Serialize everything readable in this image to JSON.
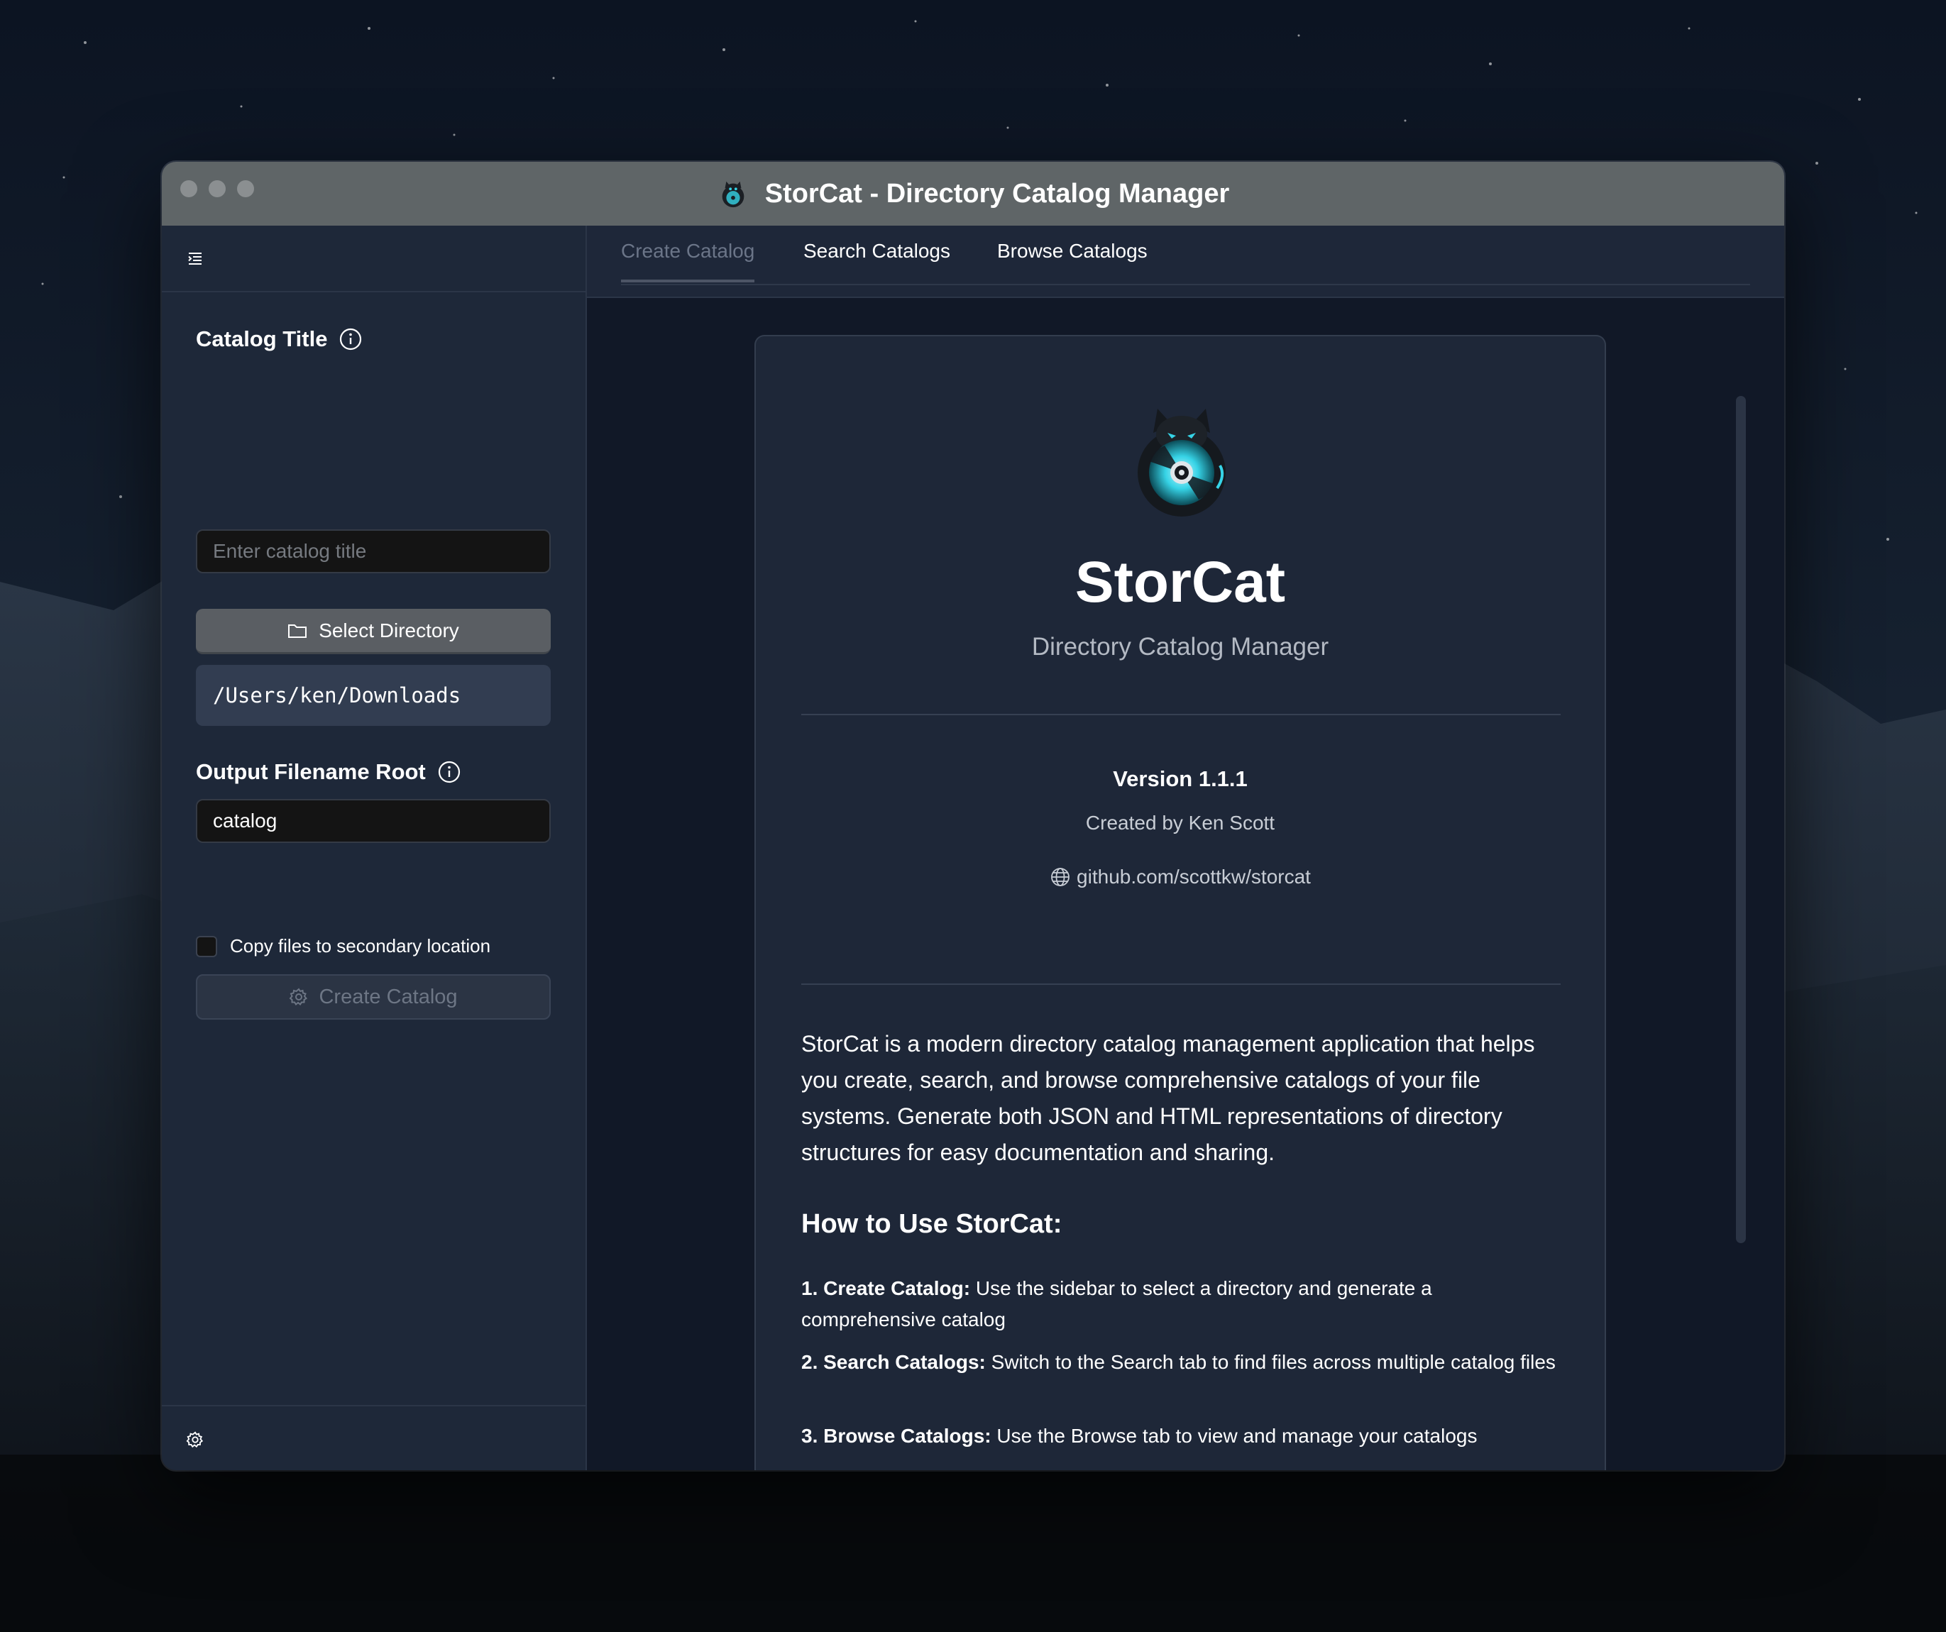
{
  "window": {
    "title": "StorCat - Directory Catalog Manager"
  },
  "sidebar": {
    "catalog_title_label": "Catalog Title",
    "catalog_title_placeholder": "Enter catalog title",
    "catalog_title_value": "",
    "select_directory_label": "Select Directory",
    "selected_path": "/Users/ken/Downloads",
    "output_root_label": "Output Filename Root",
    "output_root_value": "catalog",
    "copy_checkbox_label": "Copy files to secondary location",
    "copy_checked": false,
    "create_catalog_label": "Create Catalog"
  },
  "tabs": [
    {
      "label": "Create Catalog",
      "active": true
    },
    {
      "label": "Search Catalogs",
      "active": false
    },
    {
      "label": "Browse Catalogs",
      "active": false
    }
  ],
  "about": {
    "app_name": "StorCat",
    "subtitle": "Directory Catalog Manager",
    "version": "Version 1.1.1",
    "author": "Created by Ken Scott",
    "link": "github.com/scottkw/storcat",
    "description": "StorCat is a modern directory catalog management application that helps you create, search, and browse comprehensive catalogs of your file systems. Generate both JSON and HTML representations of directory structures for easy documentation and sharing.",
    "howto_heading": "How to Use StorCat:",
    "steps": [
      {
        "title": "1. Create Catalog:",
        "text": " Use the sidebar to select a directory and generate a comprehensive catalog"
      },
      {
        "title": "2. Search Catalogs:",
        "text": " Switch to the Search tab to find files across multiple catalog files"
      },
      {
        "title": "3. Browse Catalogs:",
        "text": " Use the Browse tab to view and manage your catalogs"
      }
    ]
  },
  "colors": {
    "sidebar_bg": "#1e2839",
    "main_bg": "#111827",
    "card_bg": "#1e2738",
    "titlebar_bg": "#5f6567",
    "accent_cyan": "#36d3e6"
  },
  "icons": {
    "sidebar_toggle": "list-indent-icon",
    "info": "info-circle-icon",
    "folder": "folder-icon",
    "gear": "gear-icon",
    "globe": "globe-icon",
    "settings": "settings-gear-icon",
    "logo": "storcat-cat-disc-logo"
  }
}
